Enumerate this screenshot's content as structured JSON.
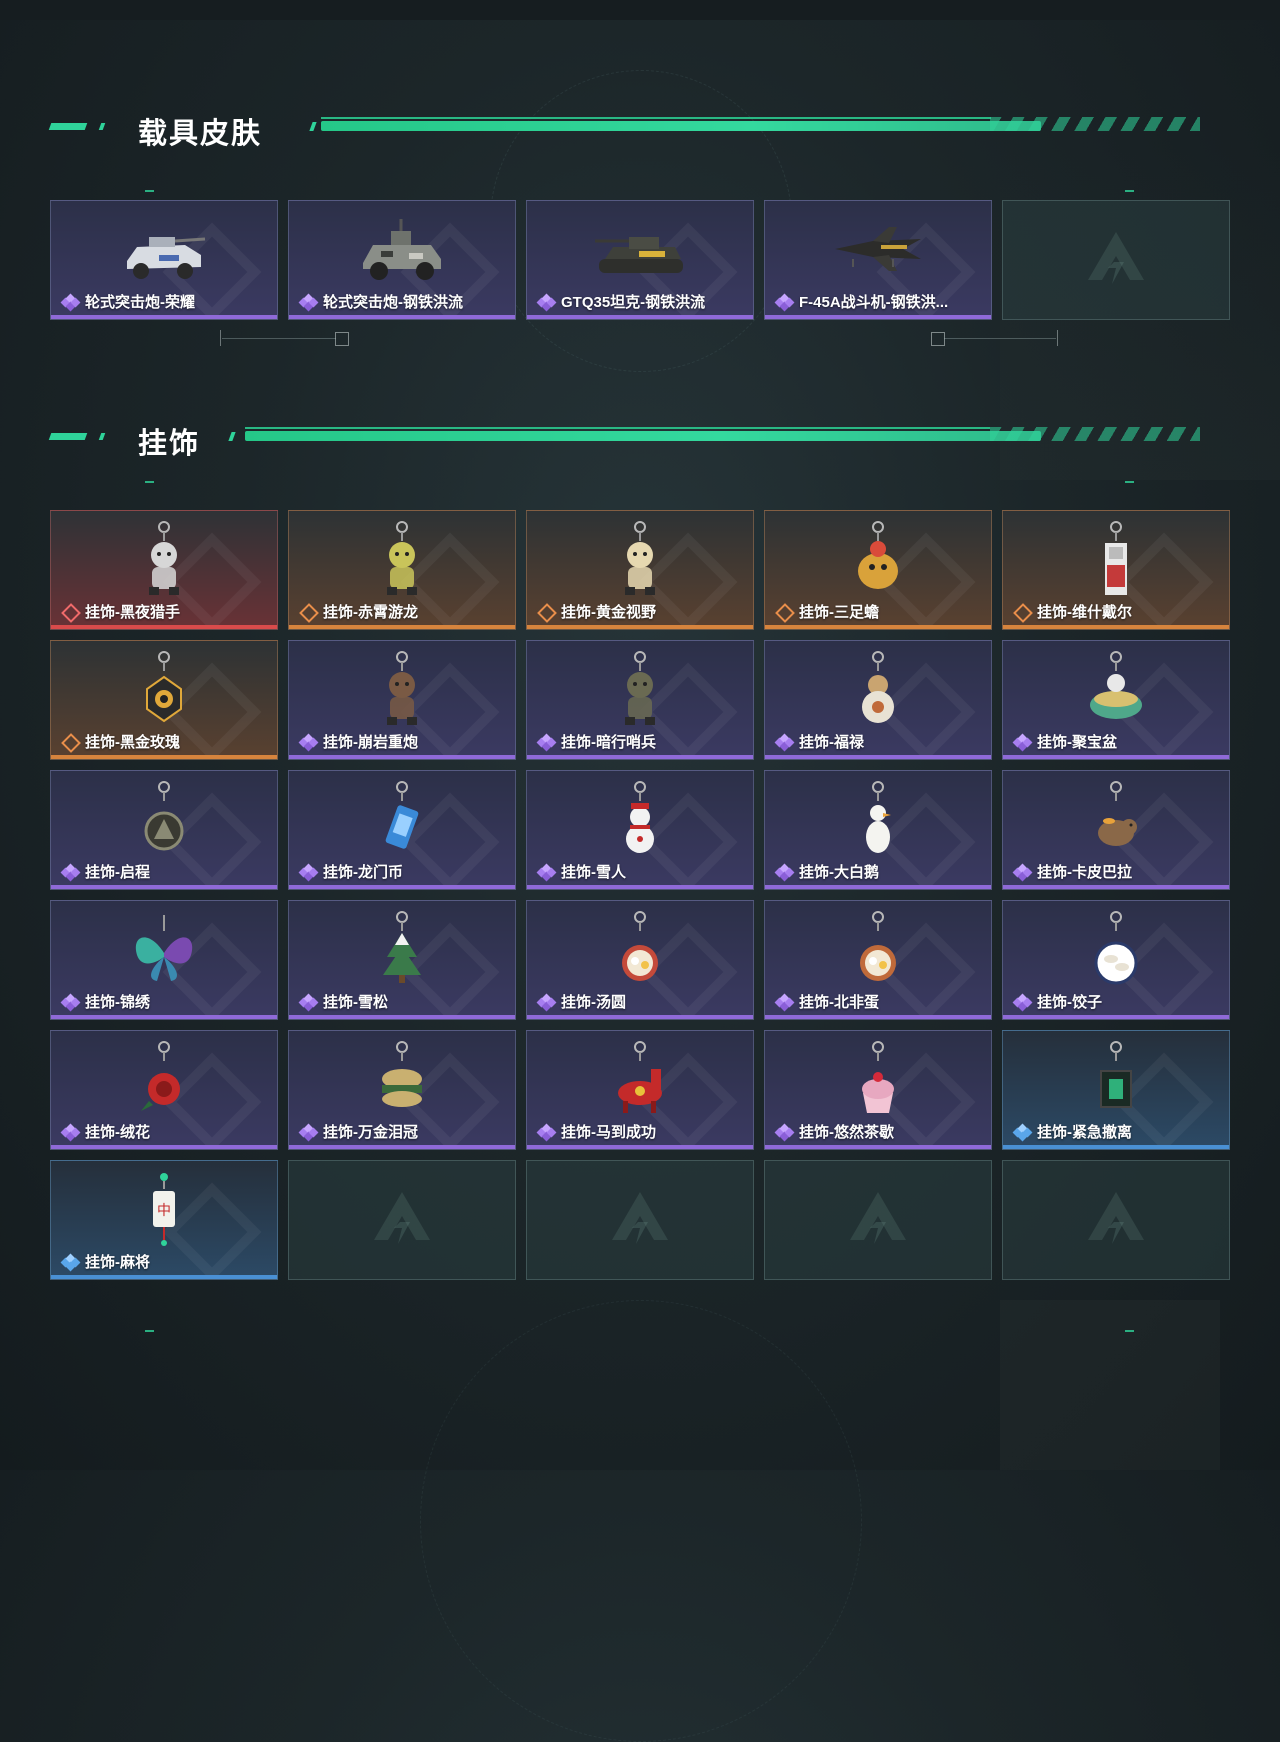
{
  "sections": {
    "vehicle": {
      "title": "载具皮肤"
    },
    "charm": {
      "title": "挂饰"
    }
  },
  "vehicle_skins": [
    {
      "label": "轮式突击炮-荣耀",
      "rarity": "purple",
      "art": "armored-car-white"
    },
    {
      "label": "轮式突击炮-钢铁洪流",
      "rarity": "purple",
      "art": "armored-car-camo"
    },
    {
      "label": "GTQ35坦克-钢铁洪流",
      "rarity": "purple",
      "art": "tank"
    },
    {
      "label": "F-45A战斗机-钢铁洪...",
      "rarity": "purple",
      "art": "fighter-jet"
    },
    {
      "label": "",
      "rarity": "empty",
      "art": ""
    }
  ],
  "charms": [
    {
      "label": "挂饰-黑夜猎手",
      "rarity": "red",
      "art": "charm-figure",
      "color": "#d7d7d7"
    },
    {
      "label": "挂饰-赤霄游龙",
      "rarity": "orange",
      "art": "charm-figure",
      "color": "#c9c45a"
    },
    {
      "label": "挂饰-黄金视野",
      "rarity": "orange",
      "art": "charm-figure",
      "color": "#e6d8b0"
    },
    {
      "label": "挂饰-三足蟾",
      "rarity": "orange",
      "art": "charm-toad",
      "color": "#d9a23a"
    },
    {
      "label": "挂饰-维什戴尔",
      "rarity": "orange",
      "art": "charm-card",
      "color": "#c43a3a"
    },
    {
      "label": "挂饰-黑金玫瑰",
      "rarity": "orange",
      "art": "charm-rose-medal",
      "color": "#e0a83a"
    },
    {
      "label": "挂饰-崩岩重炮",
      "rarity": "purple",
      "art": "charm-figure",
      "color": "#7a5a44"
    },
    {
      "label": "挂饰-暗行哨兵",
      "rarity": "purple",
      "art": "charm-figure",
      "color": "#6a6a52"
    },
    {
      "label": "挂饰-福禄",
      "rarity": "purple",
      "art": "charm-gourd",
      "color": "#c9a470"
    },
    {
      "label": "挂饰-聚宝盆",
      "rarity": "purple",
      "art": "charm-bowl",
      "color": "#4fa88a"
    },
    {
      "label": "挂饰-启程",
      "rarity": "purple",
      "art": "charm-medal",
      "color": "#8a8a74"
    },
    {
      "label": "挂饰-龙门币",
      "rarity": "purple",
      "art": "charm-coin",
      "color": "#3a8ad8"
    },
    {
      "label": "挂饰-雪人",
      "rarity": "purple",
      "art": "charm-snowman",
      "color": "#f2f2f2"
    },
    {
      "label": "挂饰-大白鹅",
      "rarity": "purple",
      "art": "charm-goose",
      "color": "#f4f4f0"
    },
    {
      "label": "挂饰-卡皮巴拉",
      "rarity": "purple",
      "art": "charm-capybara",
      "color": "#8a6848"
    },
    {
      "label": "挂饰-锦绣",
      "rarity": "purple",
      "art": "charm-butterfly",
      "color": "#3ab0a0"
    },
    {
      "label": "挂饰-雪松",
      "rarity": "purple",
      "art": "charm-tree",
      "color": "#3a7a4a"
    },
    {
      "label": "挂饰-汤圆",
      "rarity": "purple",
      "art": "charm-bowl-round",
      "color": "#c44a3a"
    },
    {
      "label": "挂饰-北非蛋",
      "rarity": "purple",
      "art": "charm-bowl-round",
      "color": "#c06a3a"
    },
    {
      "label": "挂饰-饺子",
      "rarity": "purple",
      "art": "charm-plate",
      "color": "#e8e2d4"
    },
    {
      "label": "挂饰-绒花",
      "rarity": "purple",
      "art": "charm-flower",
      "color": "#c42a2a"
    },
    {
      "label": "挂饰-万金泪冠",
      "rarity": "purple",
      "art": "charm-burger",
      "color": "#c9b070"
    },
    {
      "label": "挂饰-马到成功",
      "rarity": "purple",
      "art": "charm-horse",
      "color": "#c42a2a"
    },
    {
      "label": "挂饰-悠然茶歇",
      "rarity": "purple",
      "art": "charm-cupcake",
      "color": "#e7a8c0"
    },
    {
      "label": "挂饰-紧急撤离",
      "rarity": "blue",
      "art": "charm-sign",
      "color": "#2fb07a"
    },
    {
      "label": "挂饰-麻将",
      "rarity": "blue",
      "art": "charm-mahjong",
      "color": "#f2f2ec"
    },
    {
      "label": "",
      "rarity": "empty",
      "art": ""
    },
    {
      "label": "",
      "rarity": "empty",
      "art": ""
    },
    {
      "label": "",
      "rarity": "empty",
      "art": ""
    },
    {
      "label": "",
      "rarity": "empty",
      "art": ""
    }
  ],
  "palette": {
    "accent_green": "#2fd39a",
    "rarity_purple": "#8f6ad8",
    "rarity_orange": "#d7843d",
    "rarity_red": "#d94b4b",
    "rarity_blue": "#4a90d4"
  }
}
